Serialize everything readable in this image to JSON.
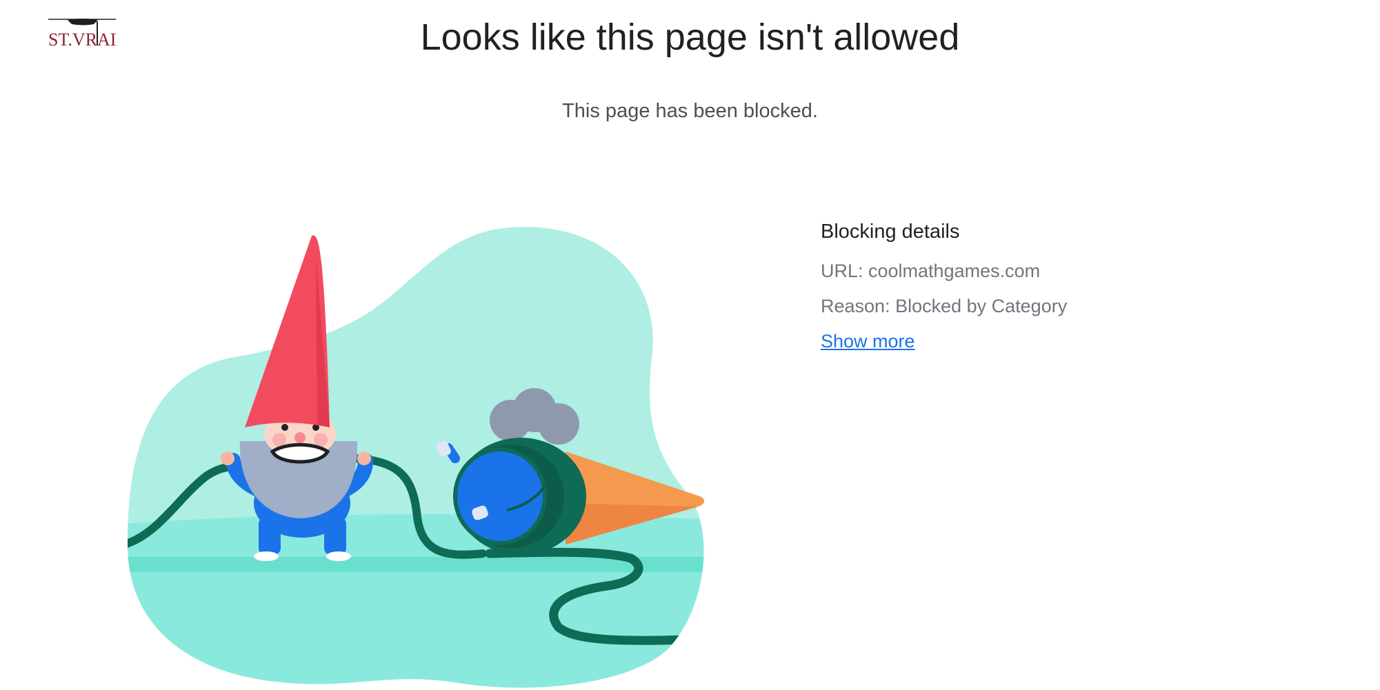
{
  "logo": {
    "text": "ST.VRAIN",
    "color": "#8b2332",
    "icon": "graduation-cap-icon"
  },
  "header": {
    "title": "Looks like this page isn't allowed",
    "subtitle": "This page has been blocked."
  },
  "illustration": {
    "icon": "gnome-pulling-hose-illustration",
    "colors": {
      "blob": "#aeeee3",
      "ground": "#8ae9dd",
      "hose": "#0e6b55",
      "hat": "#f24b5f",
      "suit": "#1a73e8",
      "cone": "#f59a4e"
    }
  },
  "details": {
    "heading": "Blocking details",
    "url": "URL: coolmathgames.com",
    "reason": "Reason: Blocked by Category",
    "show_more": "Show more",
    "link_color": "#1a73e8"
  }
}
